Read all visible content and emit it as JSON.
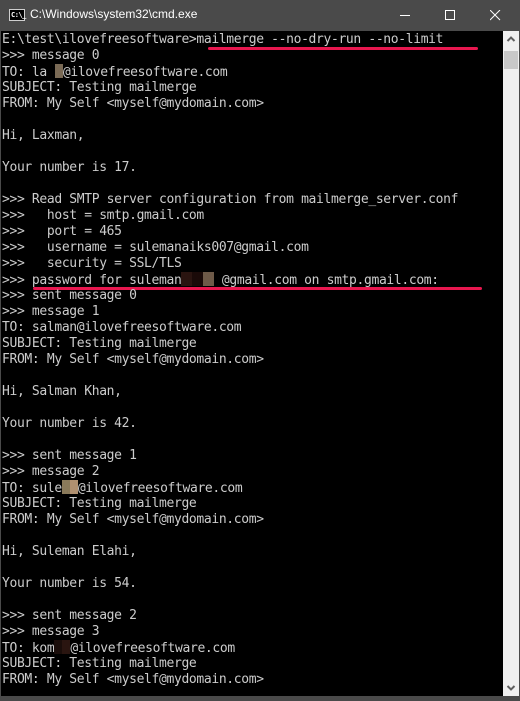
{
  "window": {
    "title": "C:\\Windows\\system32\\cmd.exe",
    "icon": "cmd-icon",
    "icon_text": "C:\\_",
    "controls": [
      "minimize-icon",
      "maximize-icon",
      "close-icon"
    ]
  },
  "console": {
    "background": "#000000",
    "text_color": "#cccccc",
    "highlight_color": "#e8174f",
    "lines": [
      "E:\\test\\ilovefreesoftware>mailmerge --no-dry-run --no-limit",
      ">>> message 0",
      "TO: la",
      "SUBJECT: Testing mailmerge",
      "FROM: My Self <myself@mydomain.com>",
      "",
      "Hi, Laxman,",
      "",
      "Your number is 17.",
      "",
      ">>> Read SMTP server configuration from mailmerge_server.conf",
      ">>>   host = smtp.gmail.com",
      ">>>   port = 465",
      ">>>   username = sulemanaiks007@gmail.com",
      ">>>   security = SSL/TLS",
      ">>> password for suleman",
      ">>> sent message 0",
      ">>> message 1",
      "TO: salman@ilovefreesoftware.com",
      "SUBJECT: Testing mailmerge",
      "FROM: My Self <myself@mydomain.com>",
      "",
      "Hi, Salman Khan,",
      "",
      "Your number is 42.",
      "",
      ">>> sent message 1",
      ">>> message 2",
      "TO: sule",
      "SUBJECT: Testing mailmerge",
      "FROM: My Self <myself@mydomain.com>",
      "",
      "Hi, Suleman Elahi,",
      "",
      "Your number is 54.",
      "",
      ">>> sent message 2",
      ">>> message 3",
      "TO: kom",
      "SUBJECT: Testing mailmerge",
      "FROM: My Self <myself@mydomain.com>"
    ],
    "line_suffixes": {
      "2": "@ilovefreesoftware.com",
      "15": " @gmail.com on smtp.gmail.com:",
      "28": "@ilovefreesoftware.com",
      "38": "@ilovefreesoftware.com"
    },
    "redactions": [
      {
        "line": 2,
        "colors": [
          "#000000",
          "#7a6a55"
        ]
      },
      {
        "line": 15,
        "colors": [
          "#2a1410",
          "#1a0a08",
          "#6e5a48"
        ]
      },
      {
        "line": 28,
        "colors": [
          "#8a7a5a",
          "#b09070"
        ]
      },
      {
        "line": 38,
        "colors": [
          "#1a0d0a",
          "#2a1510"
        ]
      }
    ],
    "underlined": [
      {
        "line": 0,
        "label": "command-highlight"
      },
      {
        "line": 15,
        "label": "password-prompt-highlight"
      }
    ]
  },
  "scrollbar": {
    "up_icon": "chevron-up-icon",
    "down_icon": "chevron-down-icon",
    "position_fraction": 0.0
  }
}
